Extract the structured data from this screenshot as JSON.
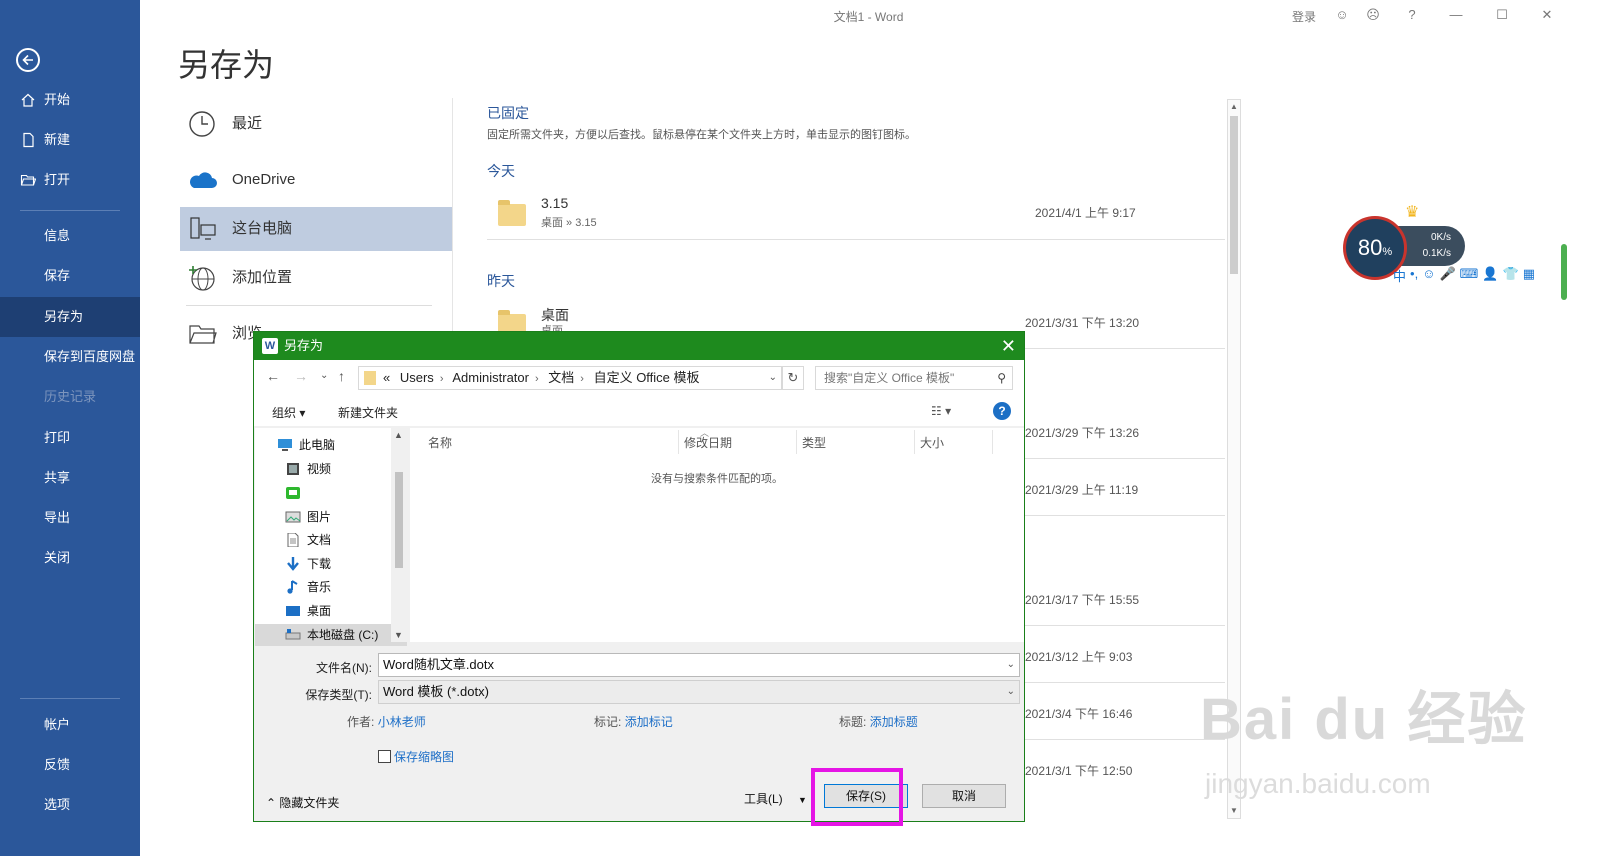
{
  "window": {
    "title": "文档1  -  Word",
    "login": "登录"
  },
  "nav": {
    "items": [
      {
        "label": "开始"
      },
      {
        "label": "新建"
      },
      {
        "label": "打开"
      },
      {
        "label": "信息"
      },
      {
        "label": "保存"
      },
      {
        "label": "另存为"
      },
      {
        "label": "保存到百度网盘"
      },
      {
        "label": "历史记录"
      },
      {
        "label": "打印"
      },
      {
        "label": "共享"
      },
      {
        "label": "导出"
      },
      {
        "label": "关闭"
      },
      {
        "label": "帐户"
      },
      {
        "label": "反馈"
      },
      {
        "label": "选项"
      }
    ]
  },
  "page_title": "另存为",
  "locations": [
    {
      "label": "最近"
    },
    {
      "label": "OneDrive"
    },
    {
      "label": "这台电脑"
    },
    {
      "label": "添加位置"
    },
    {
      "label": "浏览"
    }
  ],
  "pinned": {
    "title": "已固定",
    "desc": "固定所需文件夹，方便以后查找。鼠标悬停在某个文件夹上方时，单击显示的图钉图标。"
  },
  "groups": {
    "today": "今天",
    "yesterday": "昨天"
  },
  "recent": [
    {
      "name": "3.15",
      "path": "桌面 » 3.15",
      "date": "2021/4/1 上午 9:17"
    },
    {
      "name": "桌面",
      "path": "桌面",
      "date": "2021/3/31 下午 13:20"
    }
  ],
  "other_dates": [
    "2021/3/29 下午 13:26",
    "2021/3/29 上午 11:19",
    "2021/3/17 下午 15:55",
    "2021/3/12 上午 9:03",
    "2021/3/4 下午 16:46",
    "2021/3/1 下午 12:50"
  ],
  "speed_widget": {
    "percent": "80",
    "unit": "%",
    "up": "0K/s",
    "down": "0.1K/s"
  },
  "dialog": {
    "title": "另存为",
    "word_logo": "W",
    "address": {
      "prefix": "«",
      "crumbs": [
        "Users",
        "Administrator",
        "文档",
        "自定义 Office 模板"
      ]
    },
    "search_placeholder": "搜索\"自定义 Office 模板\"",
    "toolbar": {
      "organize": "组织 ▾",
      "new_folder": "新建文件夹"
    },
    "help_label": "?",
    "tree": [
      {
        "label": "此电脑"
      },
      {
        "label": "视频"
      },
      {
        "label": ""
      },
      {
        "label": "图片"
      },
      {
        "label": "文档"
      },
      {
        "label": "下载"
      },
      {
        "label": "音乐"
      },
      {
        "label": "桌面"
      },
      {
        "label": "本地磁盘 (C:)"
      }
    ],
    "columns": [
      "名称",
      "修改日期",
      "类型",
      "大小"
    ],
    "empty_text": "没有与搜索条件匹配的项。",
    "filename_label": "文件名(N):",
    "filename_value": "Word随机文章.dotx",
    "filetype_label": "保存类型(T):",
    "filetype_value": "Word 模板 (*.dotx)",
    "author_label": "作者:",
    "author_value": "小林老师",
    "tags_label": "标记:",
    "tags_value": "添加标记",
    "subject_label": "标题:",
    "subject_value": "添加标题",
    "thumbnail_label": "保存缩略图",
    "hide_folders": "隐藏文件夹",
    "tools": "工具(L)",
    "save_button": "保存(S)",
    "cancel_button": "取消"
  },
  "watermark": {
    "main": "Bai du 经验",
    "sub": "jingyan.baidu.com"
  },
  "colors": {
    "nav_bg": "#2b579a",
    "nav_active": "#1e3f73",
    "dialog_title": "#1e8a1e",
    "highlight": "#e515e5"
  }
}
